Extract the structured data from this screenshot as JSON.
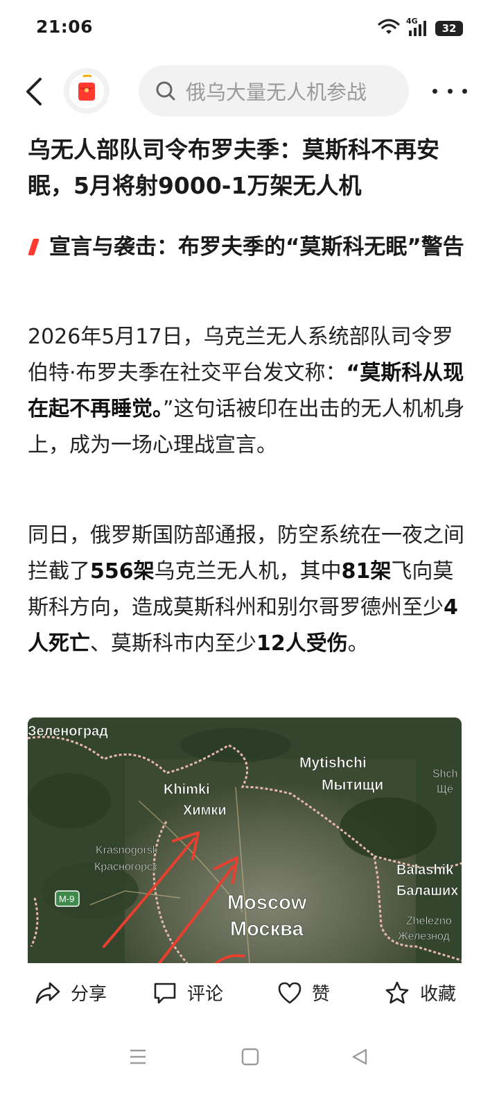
{
  "status_bar": {
    "time": "21:06",
    "network": "4G",
    "battery": "32"
  },
  "top_bar": {
    "search_placeholder": "俄乌大量无人机参战"
  },
  "article": {
    "title": "乌无人部队司令布罗夫季：莫斯科不再安眠，5月将射9000-1万架无人机",
    "section_heading": "宣言与袭击：布罗夫季的“莫斯科无眠”警告",
    "p1": {
      "a": "2026年5月17日，乌克兰无人系统部队司令罗伯特·布罗夫季在社交平台发文称：",
      "b": "“莫斯科从现在起不再睡觉。",
      "c": "”这句话被印在出击的无人机机身上，成为一场心理战宣言。"
    },
    "p2": {
      "a": "同日，俄罗斯国防部通报，防空系统在一夜之间拦截了",
      "b": "556架",
      "c": "乌克兰无人机，其中",
      "d": "81架",
      "e": "飞向莫斯科方向，造成莫斯科州和别尔哥罗德州至少",
      "f": "4人死亡",
      "g": "、莫斯科市内至少",
      "h": "12人受伤",
      "i": "。"
    }
  },
  "map": {
    "labels": {
      "zelenograd": "Зеленоград",
      "mytishchi_en": "Mytishchi",
      "mytishchi_ru": "Мытищи",
      "shch_en": "Shch",
      "shch_ru": "Щё",
      "khimki_en": "Khimki",
      "khimki_ru": "Химки",
      "krasnogorsk_en": "Krasnogorsk",
      "krasnogorsk_ru": "Красногорск",
      "road": "M-9",
      "balashikha_en": "Balashik",
      "balashikha_ru": "Балаших",
      "moscow_en": "Moscow",
      "moscow_ru": "Москва",
      "zhelezno_en": "Zhelezno",
      "zhelezno_ru": "Железнод"
    }
  },
  "actions": {
    "share": "分享",
    "comment": "评论",
    "like": "赞",
    "favorite": "收藏"
  }
}
